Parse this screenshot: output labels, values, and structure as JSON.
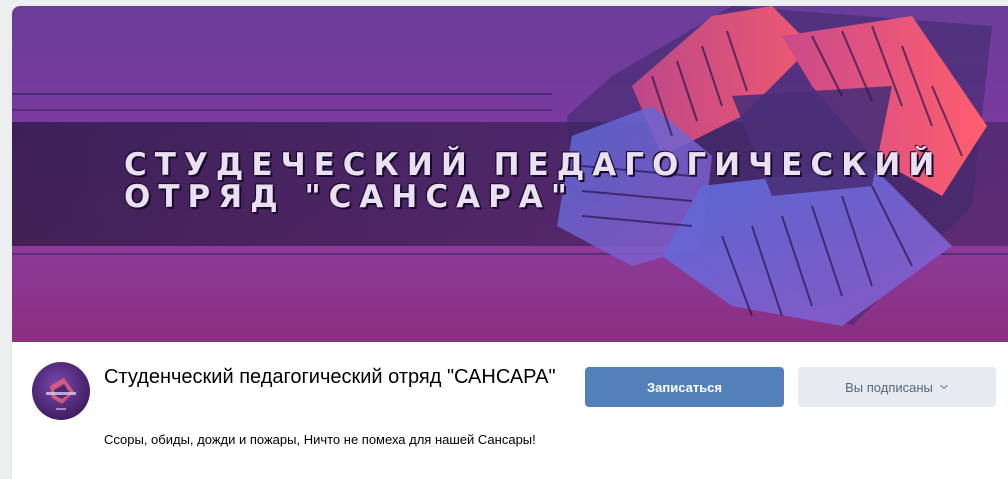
{
  "cover": {
    "title": "СТУДЕЧЕСКИЙ ПЕДАГОГИЧЕСКИЙ\nОТРЯД \"САНСАРА\""
  },
  "group": {
    "name": "Студенческий педагогический отряд \"САНСАРА\"",
    "status": "Ссоры, обиды, дожди и пожары, Ничто не помеха для нашей Сансары!"
  },
  "actions": {
    "join_label": "Записаться",
    "subscribed_label": "Вы подписаны",
    "subscribed_icon": "chevron-down-icon"
  },
  "colors": {
    "primary_button": "#5181b8",
    "secondary_button": "#e5ebf1",
    "secondary_text": "#55677d"
  }
}
